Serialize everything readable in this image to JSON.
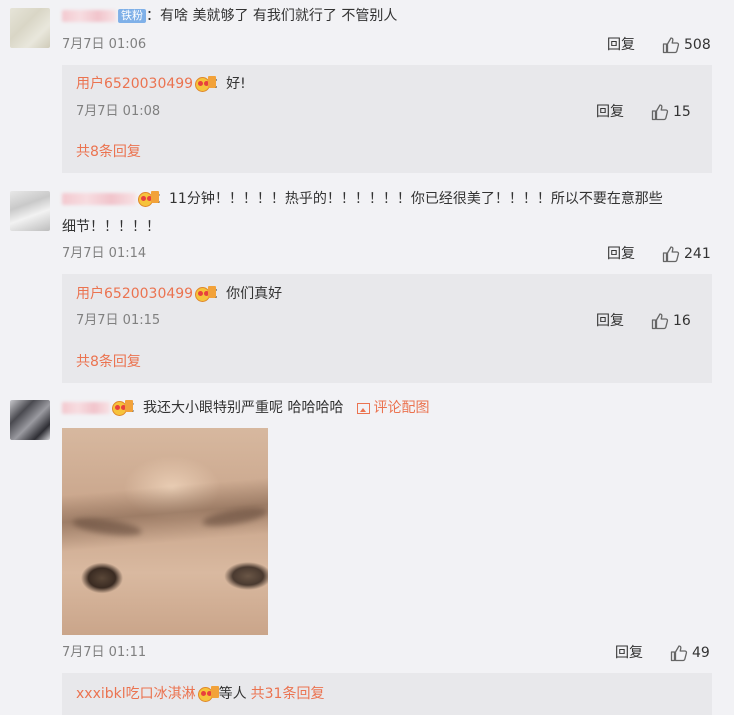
{
  "comments": [
    {
      "badge": "铁粉",
      "text": "：有啥 美就够了 有我们就行了 不管别人",
      "time": "7月7日 01:06",
      "reply": "回复",
      "likes": "508",
      "sub_reply": {
        "user": "用户6520030499",
        "text": "：好!",
        "time": "7月7日 01:08",
        "reply": "回复",
        "likes": "15"
      },
      "more": "共8条回复"
    },
    {
      "text_line1": "：11分钟！！！！！热乎的！！！！！！你已经很美了！！！！所以不要在意那些",
      "text_line2": "细节！！！！！",
      "time": "7月7日 01:14",
      "reply": "回复",
      "likes": "241",
      "sub_reply": {
        "user": "用户6520030499",
        "text": "：你们真好",
        "time": "7月7日 01:15",
        "reply": "回复",
        "likes": "16"
      },
      "more": "共8条回复"
    },
    {
      "text": "：我还大小眼特别严重呢 哈哈哈哈",
      "pic_link": "评论配图",
      "time": "7月7日 01:11",
      "reply": "回复",
      "likes": "49",
      "sub_user": "xxxibkl吃口冰淇淋",
      "sub_suffix": "等人",
      "more": "共31条回复"
    }
  ],
  "icons": {
    "like": "thumbs-up-icon",
    "picture": "picture-icon",
    "fan_badge": "heart-eyes-badge-icon"
  },
  "colors": {
    "link": "#eb7350",
    "background": "#f2f2f5",
    "subreply_bg": "#e8e8eb",
    "fan_badge_blue": "#7fb0e8"
  }
}
